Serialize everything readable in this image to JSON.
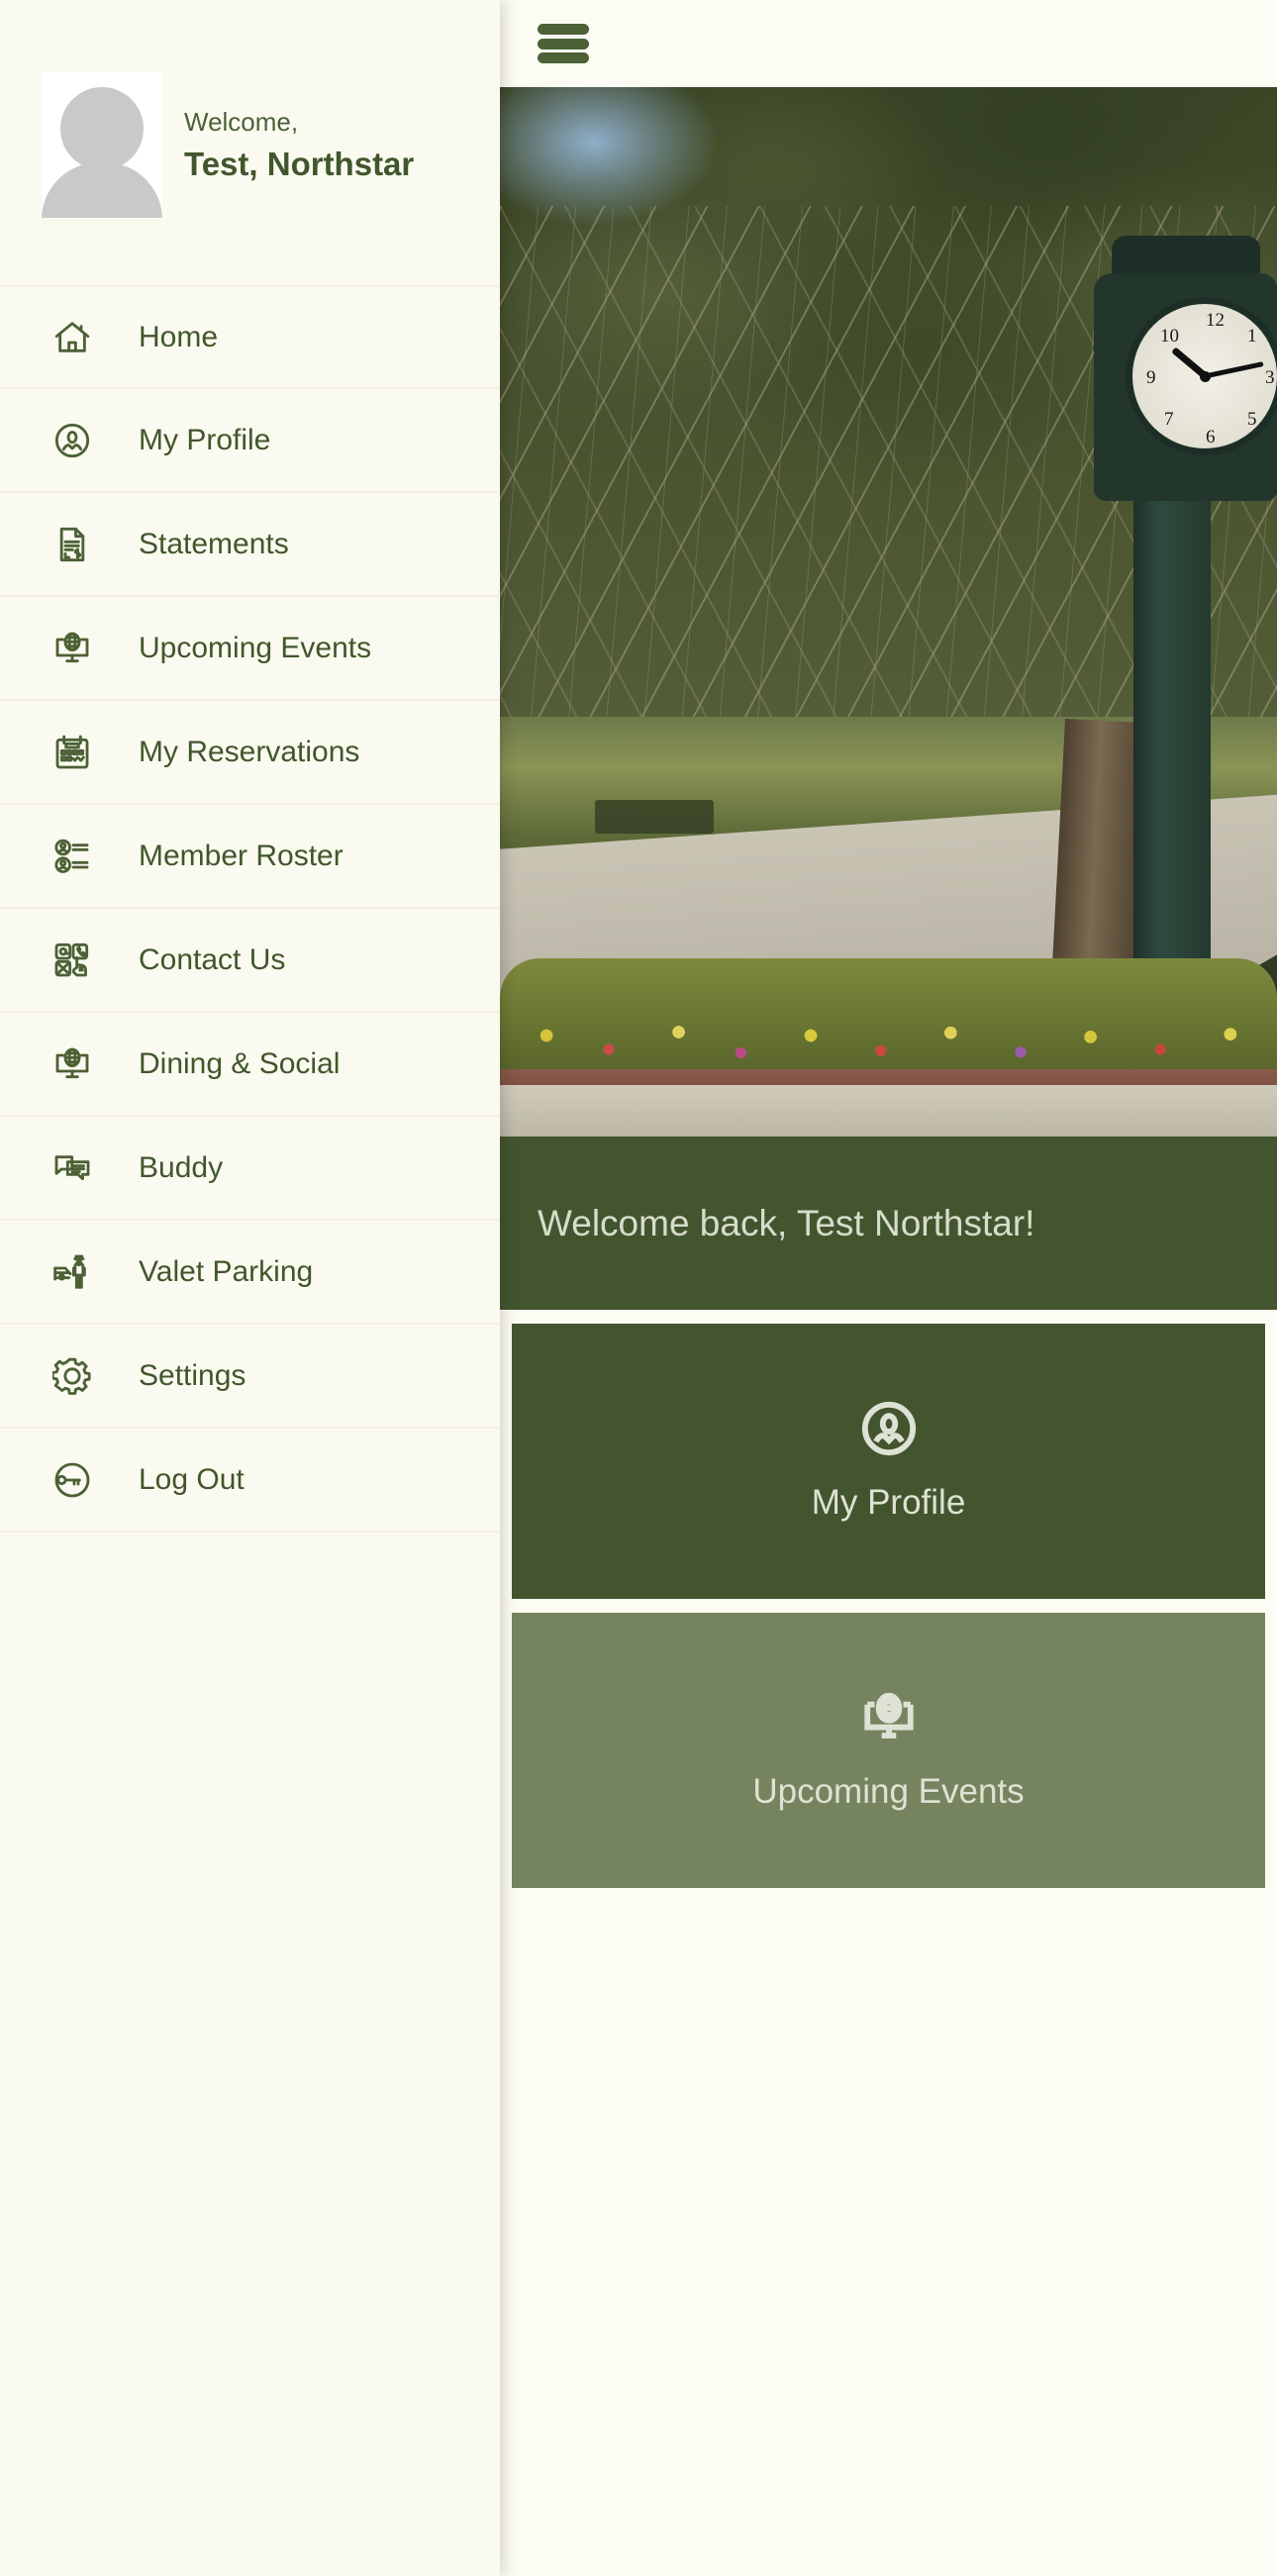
{
  "drawer": {
    "greeting_line": "Welcome,",
    "user_name": "Test, Northstar",
    "avatar_icon": "user-avatar-placeholder",
    "menu": [
      {
        "label": "Home",
        "icon": "home-icon"
      },
      {
        "label": "My Profile",
        "icon": "user-circle-icon"
      },
      {
        "label": "Statements",
        "icon": "document-dollar-icon"
      },
      {
        "label": "Upcoming Events",
        "icon": "monitor-globe-icon"
      },
      {
        "label": "My Reservations",
        "icon": "calendar-check-icon"
      },
      {
        "label": "Member Roster",
        "icon": "user-list-icon"
      },
      {
        "label": "Contact Us",
        "icon": "contact-tap-icon"
      },
      {
        "label": "Dining & Social",
        "icon": "monitor-globe-icon"
      },
      {
        "label": "Buddy",
        "icon": "chat-bubbles-icon"
      },
      {
        "label": "Valet Parking",
        "icon": "valet-car-icon"
      },
      {
        "label": "Settings",
        "icon": "gear-icon"
      },
      {
        "label": "Log Out",
        "icon": "key-circle-icon"
      }
    ]
  },
  "main": {
    "menu_button_icon": "hamburger-icon",
    "hero_image_alt": "golf-course-clock-tower-photo",
    "welcome_back": "Welcome back, Test Northstar!",
    "tiles": [
      {
        "label": "My Profile",
        "icon": "user-circle-icon",
        "bg": "#43552F"
      },
      {
        "label": "Upcoming Events",
        "icon": "monitor-globe-icon",
        "bg": "#75845F"
      }
    ]
  },
  "theme": {
    "background": "#FBFAF0",
    "surface": "#FDFCF4",
    "primary_green": "#4C6136",
    "banner_green": "#43552F",
    "tile_light_green": "#75845F",
    "text_on_green": "#DEE2D4",
    "divider": "#F2F0E2"
  }
}
